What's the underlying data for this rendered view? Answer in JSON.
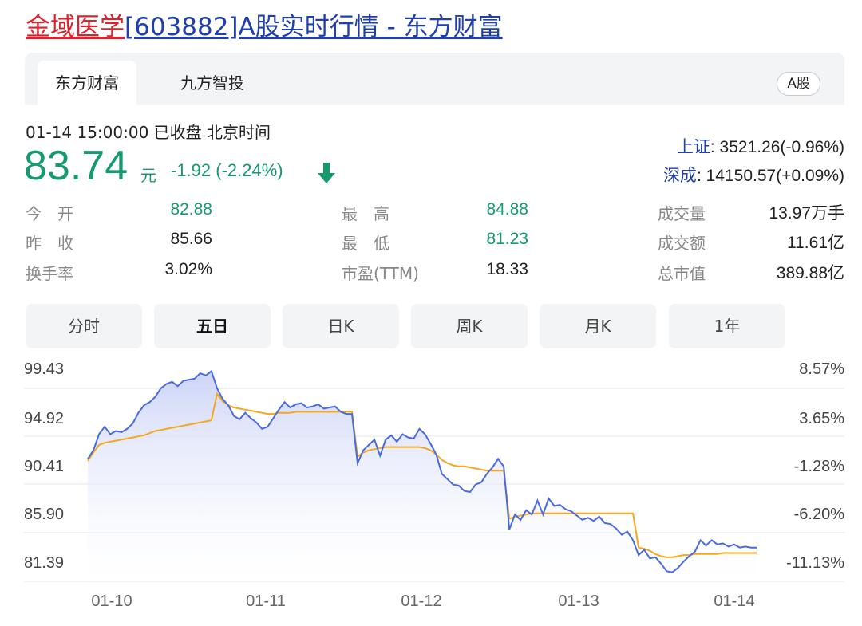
{
  "page_title": {
    "stock_name": "金域医学",
    "rest": "[603882]A股实时行情 - 东方财富"
  },
  "tabs": {
    "items": [
      "东方财富",
      "九方智投"
    ],
    "badge": "A股"
  },
  "quote": {
    "datetime": "01-14 15:00:00  已收盘  北京时间",
    "price": "83.74",
    "unit": "元",
    "change": "-1.92 (-2.24%)"
  },
  "indices": [
    {
      "name": "上证",
      "value": ": 3521.26(-0.96%)"
    },
    {
      "name": "深成",
      "value": ": 14150.57(+0.09%)"
    }
  ],
  "stats": [
    {
      "label": "今　开",
      "value": "82.88",
      "color": "green"
    },
    {
      "label": "最　高",
      "value": "84.88",
      "color": "green"
    },
    {
      "label": "成交量",
      "value": "13.97万手",
      "color": "dark"
    },
    {
      "label": "昨　收",
      "value": "85.66",
      "color": "dark"
    },
    {
      "label": "最　低",
      "value": "81.23",
      "color": "green"
    },
    {
      "label": "成交额",
      "value": "11.61亿",
      "color": "dark"
    },
    {
      "label": "换手率",
      "value": "3.02%",
      "color": "dark"
    },
    {
      "label": "市盈(TTM)",
      "value": "18.33",
      "color": "dark"
    },
    {
      "label": "总市值",
      "value": "389.88亿",
      "color": "dark"
    }
  ],
  "periods": {
    "items": [
      "分时",
      "五日",
      "日K",
      "周K",
      "月K",
      "1年"
    ],
    "active_index": 1
  },
  "colors": {
    "price_line": "#4a6ae0",
    "avg_line": "#f4a81d",
    "fill_top": "#c7d0f5",
    "grid": "#e6e6e6",
    "down": "#159a6c",
    "index_link": "#1f3fae",
    "title_red": "#e0202a"
  },
  "chart_data": {
    "type": "line",
    "y_left_ticks": [
      "99.43",
      "94.92",
      "90.41",
      "85.90",
      "81.39"
    ],
    "y_right_ticks": [
      "8.57%",
      "3.65%",
      "-1.28%",
      "-6.20%",
      "-11.13%"
    ],
    "ylim": [
      81.39,
      99.43
    ],
    "x_labels": [
      "01-10",
      "01-11",
      "01-12",
      "01-13",
      "01-14"
    ],
    "series": [
      {
        "values": [
          91.2,
          92.0,
          93.5,
          94.2,
          93.5,
          93.8,
          93.7,
          94.0,
          94.5,
          95.5,
          96.2,
          96.5,
          97.0,
          97.8,
          98.2,
          98.4,
          98.0,
          98.5,
          98.6,
          98.7,
          99.2,
          99.0,
          99.4,
          97.8,
          96.8,
          96.2,
          95.2,
          94.9,
          95.5,
          95.0,
          94.6,
          94.0,
          94.2,
          95.0,
          95.8,
          96.5,
          96.0,
          96.3,
          96.4,
          96.0,
          96.1,
          96.3,
          95.9,
          96.0,
          96.1,
          95.6,
          95.4,
          95.4,
          90.8,
          92.0,
          92.5,
          93.0,
          91.5,
          93.0,
          93.4,
          92.8,
          93.5,
          93.2,
          93.1,
          94.0,
          93.5,
          92.6,
          91.6,
          89.8,
          89.3,
          88.8,
          88.7,
          88.2,
          88.1,
          88.8,
          89.0,
          89.8,
          90.4,
          91.2,
          90.5,
          84.6,
          86.0,
          85.5,
          86.4,
          86.0,
          87.3,
          86.0,
          87.5,
          86.8,
          86.9,
          86.5,
          86.3,
          85.9,
          85.5,
          85.7,
          85.4,
          85.8,
          85.2,
          85.1,
          84.7,
          84.1,
          84.4,
          83.6,
          82.2,
          82.7,
          81.9,
          82.0,
          81.4,
          80.7,
          80.6,
          81.0,
          81.6,
          82.1,
          82.5,
          83.6,
          83.1,
          83.6,
          83.2,
          83.3,
          83.0,
          83.2,
          82.9,
          83.0,
          82.9,
          82.9
        ]
      },
      {
        "values": [
          91.0,
          91.8,
          92.5,
          92.7,
          92.8,
          92.9,
          93.0,
          93.1,
          93.2,
          93.3,
          93.4,
          93.6,
          93.8,
          93.9,
          94.0,
          94.1,
          94.2,
          94.3,
          94.4,
          94.5,
          94.6,
          94.7,
          94.8,
          97.3,
          96.6,
          96.2,
          96.0,
          95.9,
          95.8,
          95.7,
          95.6,
          95.5,
          95.4,
          95.4,
          95.5,
          95.5,
          95.5,
          95.6,
          95.6,
          95.6,
          95.6,
          95.6,
          95.6,
          95.6,
          95.6,
          95.6,
          95.6,
          95.6,
          91.4,
          91.8,
          92.0,
          92.1,
          92.2,
          92.3,
          92.3,
          92.3,
          92.3,
          92.3,
          92.3,
          92.3,
          92.2,
          92.0,
          91.6,
          91.1,
          90.8,
          90.6,
          90.5,
          90.5,
          90.4,
          90.3,
          90.2,
          90.1,
          90.1,
          90.1,
          90.1,
          85.6,
          85.8,
          85.9,
          86.0,
          86.1,
          86.1,
          86.1,
          86.1,
          86.1,
          86.1,
          86.1,
          86.1,
          86.1,
          86.1,
          86.1,
          86.1,
          86.1,
          86.1,
          86.1,
          86.1,
          86.1,
          86.1,
          86.1,
          82.9,
          82.8,
          82.6,
          82.3,
          82.1,
          82.0,
          82.0,
          82.1,
          82.2,
          82.2,
          82.3,
          82.3,
          82.3,
          82.3,
          82.3,
          82.4,
          82.4,
          82.4,
          82.4,
          82.4,
          82.4,
          82.4
        ]
      }
    ]
  }
}
